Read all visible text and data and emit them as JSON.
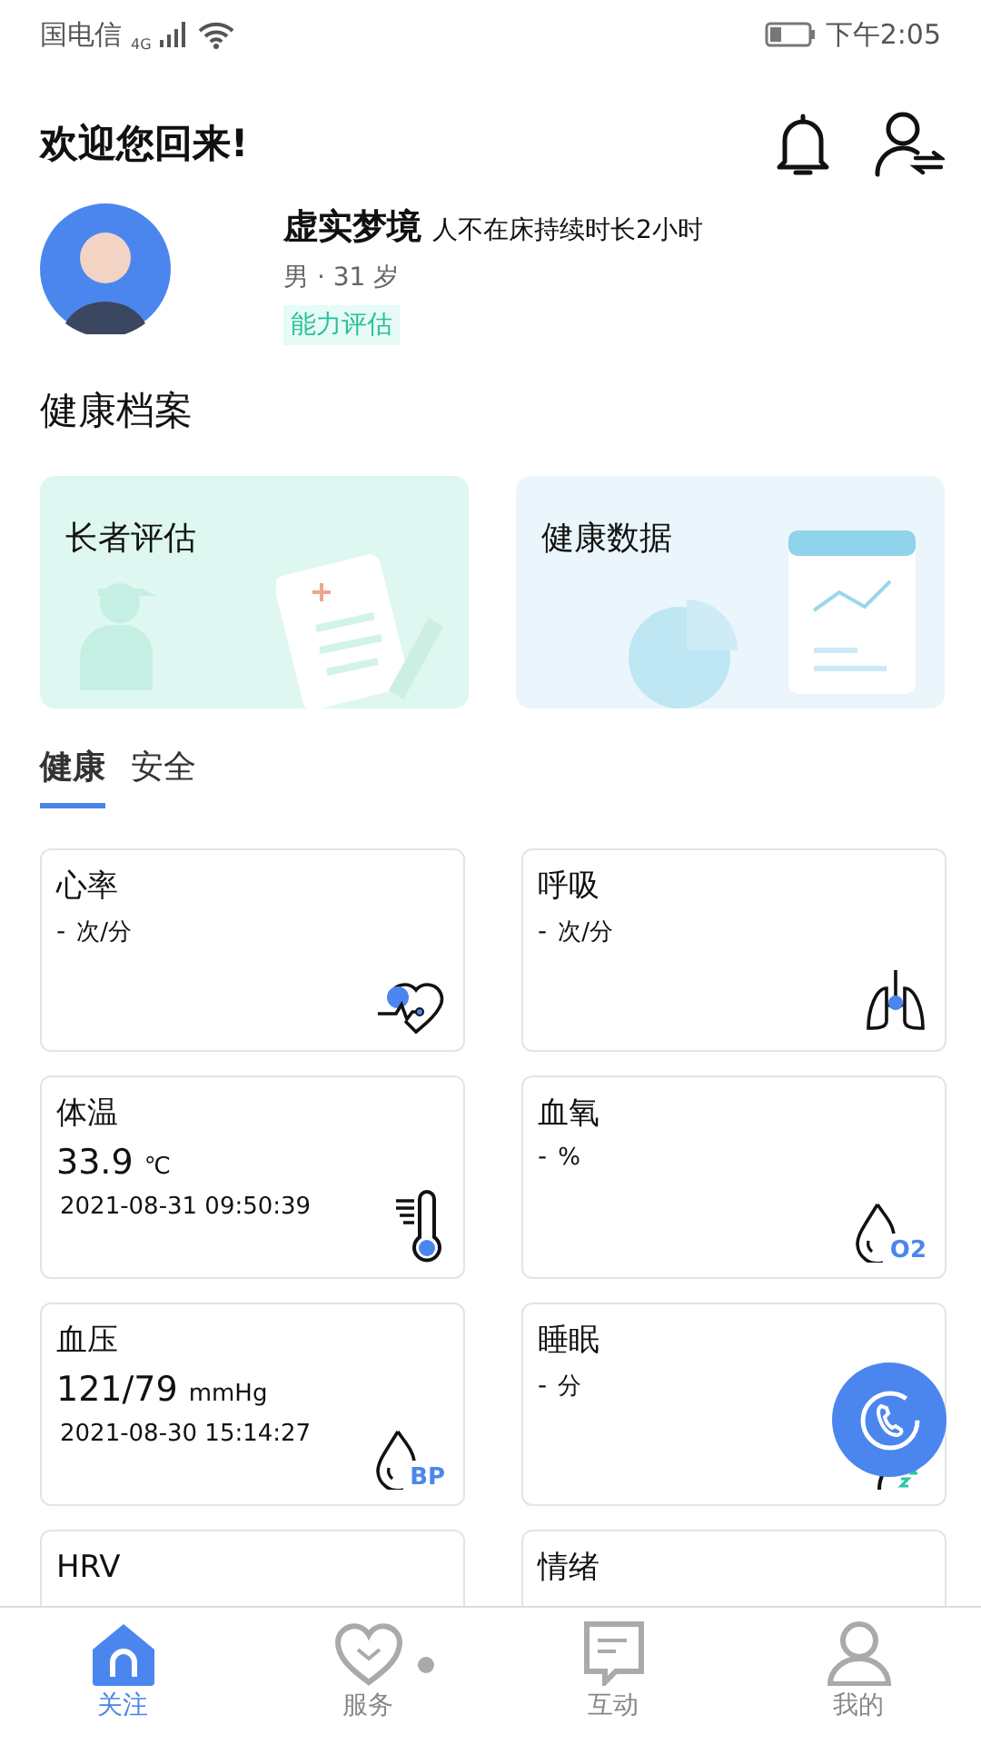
{
  "status_bar": {
    "carrier": "国电信",
    "network": "4G",
    "time": "下午2:05"
  },
  "header": {
    "welcome": "欢迎您回来!"
  },
  "profile": {
    "name": "虚实梦境",
    "status": "人不在床持续时长2小时",
    "info": "男 · 31 岁",
    "tag": "能力评估"
  },
  "section_title": "健康档案",
  "banners": [
    {
      "kind": "elder",
      "label": "长者评估"
    },
    {
      "kind": "data",
      "label": "健康数据"
    }
  ],
  "tabs": [
    {
      "label": "健康",
      "selected": true
    },
    {
      "label": "安全",
      "selected": false
    }
  ],
  "metrics": [
    {
      "kind": "heart",
      "title": "心率",
      "value": "-",
      "unit": "次/分"
    },
    {
      "kind": "lungs",
      "title": "呼吸",
      "value": "-",
      "unit": "次/分"
    },
    {
      "kind": "thermometer",
      "title": "体温",
      "value": "33.9",
      "unit": "℃",
      "time": "2021-08-31 09:50:39"
    },
    {
      "kind": "oxygen",
      "title": "血氧",
      "value": "-",
      "unit": "%",
      "icon_label": "O2"
    },
    {
      "kind": "pressure",
      "title": "血压",
      "value": "121/79",
      "unit": "mmHg",
      "time": "2021-08-30 15:14:27",
      "icon_label": "BP"
    },
    {
      "kind": "sleep",
      "title": "睡眠",
      "value": "-",
      "unit": "分"
    },
    {
      "kind": "none",
      "title": "HRV"
    },
    {
      "kind": "none",
      "title": "情绪"
    }
  ],
  "nav": [
    {
      "kind": "home",
      "label": "关注",
      "selected": true,
      "dot": false
    },
    {
      "kind": "heart",
      "label": "服务",
      "selected": false,
      "dot": true
    },
    {
      "kind": "chat",
      "label": "互动",
      "selected": false,
      "dot": false
    },
    {
      "kind": "person",
      "label": "我的",
      "selected": false,
      "dot": false
    }
  ]
}
